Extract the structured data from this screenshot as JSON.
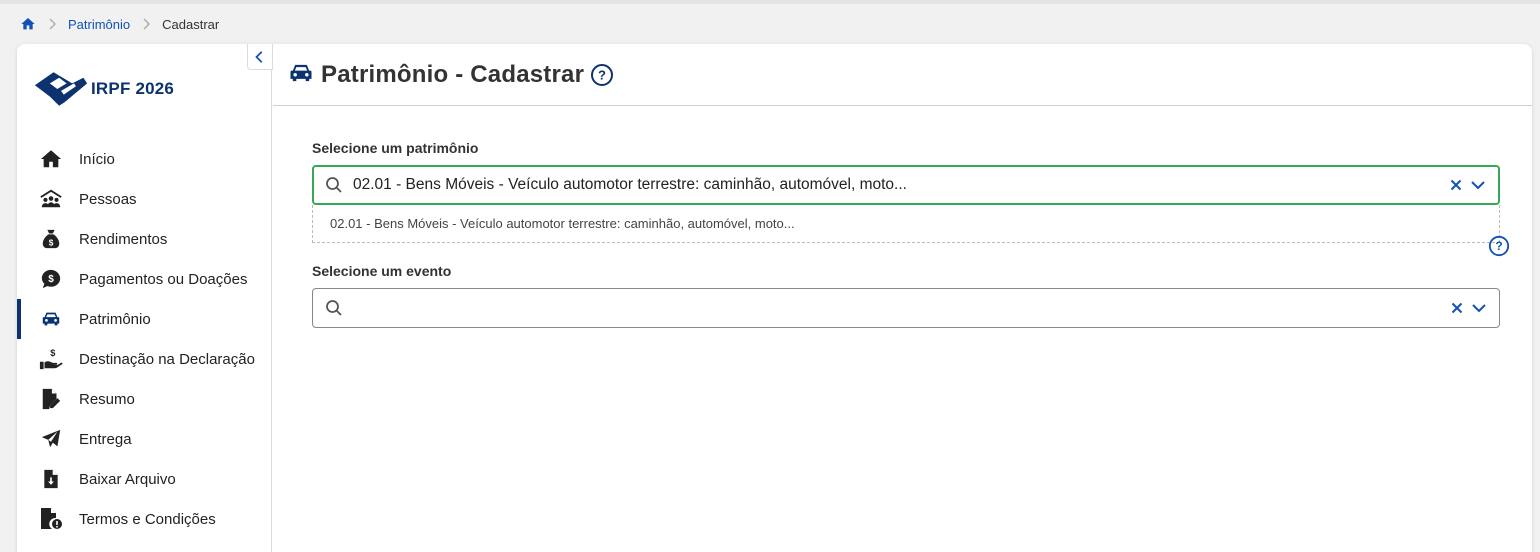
{
  "breadcrumb": {
    "items": [
      {
        "label": "Patrimônio"
      },
      {
        "label": "Cadastrar"
      }
    ]
  },
  "app": {
    "logo_text": "IRPF 2026"
  },
  "sidebar": {
    "items": [
      {
        "label": "Início",
        "icon": "home-icon"
      },
      {
        "label": "Pessoas",
        "icon": "people-icon"
      },
      {
        "label": "Rendimentos",
        "icon": "money-bag-icon"
      },
      {
        "label": "Pagamentos ou Doações",
        "icon": "dollar-bubble-icon"
      },
      {
        "label": "Patrimônio",
        "icon": "car-icon",
        "active": true
      },
      {
        "label": "Destinação na Declaração",
        "icon": "hand-coin-icon"
      },
      {
        "label": "Resumo",
        "icon": "file-edit-icon"
      },
      {
        "label": "Entrega",
        "icon": "paper-plane-icon"
      },
      {
        "label": "Baixar Arquivo",
        "icon": "file-download-icon"
      },
      {
        "label": "Termos e Condições",
        "icon": "file-alert-icon"
      }
    ]
  },
  "page": {
    "title": "Patrimônio - Cadastrar"
  },
  "form": {
    "patrimonio": {
      "label": "Selecione um patrimônio",
      "value": "02.01 - Bens Móveis - Veículo automotor terrestre: caminhão, automóvel, moto...",
      "option": "02.01 - Bens Móveis - Veículo automotor terrestre: caminhão, automóvel, moto..."
    },
    "evento": {
      "label": "Selecione um evento",
      "value": ""
    }
  },
  "colors": {
    "primary": "#1351b4",
    "dark_blue": "#0c326f",
    "focus_green": "#36a853"
  }
}
